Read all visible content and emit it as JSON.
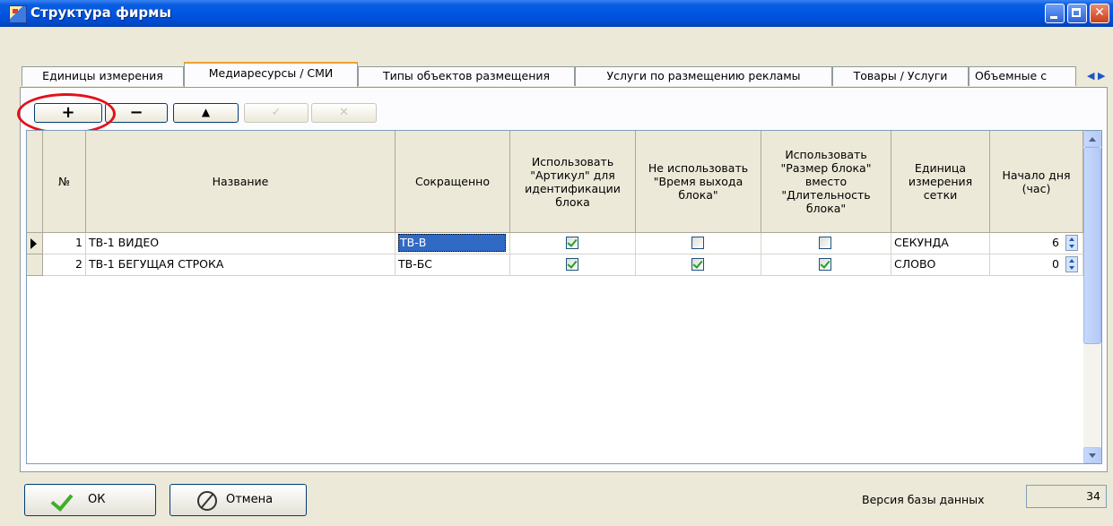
{
  "window": {
    "title": "Структура фирмы"
  },
  "tabs": [
    {
      "label": "Единицы измерения",
      "active": false
    },
    {
      "label": "Медиаресурсы / СМИ",
      "active": true
    },
    {
      "label": "Типы объектов размещения",
      "active": false
    },
    {
      "label": "Услуги по размещению рекламы",
      "active": false
    },
    {
      "label": "Товары / Услуги",
      "active": false
    },
    {
      "label": "Объемные с",
      "active": false
    }
  ],
  "toolbar": {
    "add": "+",
    "remove": "−",
    "move_up": "▲",
    "edit": "✓",
    "delete": "✕"
  },
  "grid": {
    "columns": [
      {
        "key": "num",
        "label": "№"
      },
      {
        "key": "name",
        "label": "Название"
      },
      {
        "key": "short",
        "label": "Сокращенно"
      },
      {
        "key": "article",
        "label": "Использовать \"Артикул\" для идентификации блока"
      },
      {
        "key": "no_exit_time",
        "label": "Не использовать \"Время выхода блока\""
      },
      {
        "key": "block_size",
        "label": "Использовать \"Размер блока\" вместо \"Длительность блока\""
      },
      {
        "key": "unit",
        "label": "Единица измерения сетки"
      },
      {
        "key": "day_start",
        "label": "Начало дня (час)"
      }
    ],
    "rows": [
      {
        "num": "1",
        "name": "ТВ-1 ВИДЕО",
        "short": "ТВ-В",
        "article": true,
        "no_exit_time": false,
        "block_size": false,
        "unit": "СЕКУНДА",
        "day_start": "6",
        "current": true
      },
      {
        "num": "2",
        "name": "ТВ-1 БЕГУЩАЯ СТРОКА",
        "short": "ТВ-БС",
        "article": true,
        "no_exit_time": true,
        "block_size": true,
        "unit": "СЛОВО",
        "day_start": "0",
        "current": false
      }
    ]
  },
  "footer": {
    "ok": "ОК",
    "cancel": "Отмена",
    "db_version_label": "Версия базы данных",
    "db_version": "34"
  }
}
